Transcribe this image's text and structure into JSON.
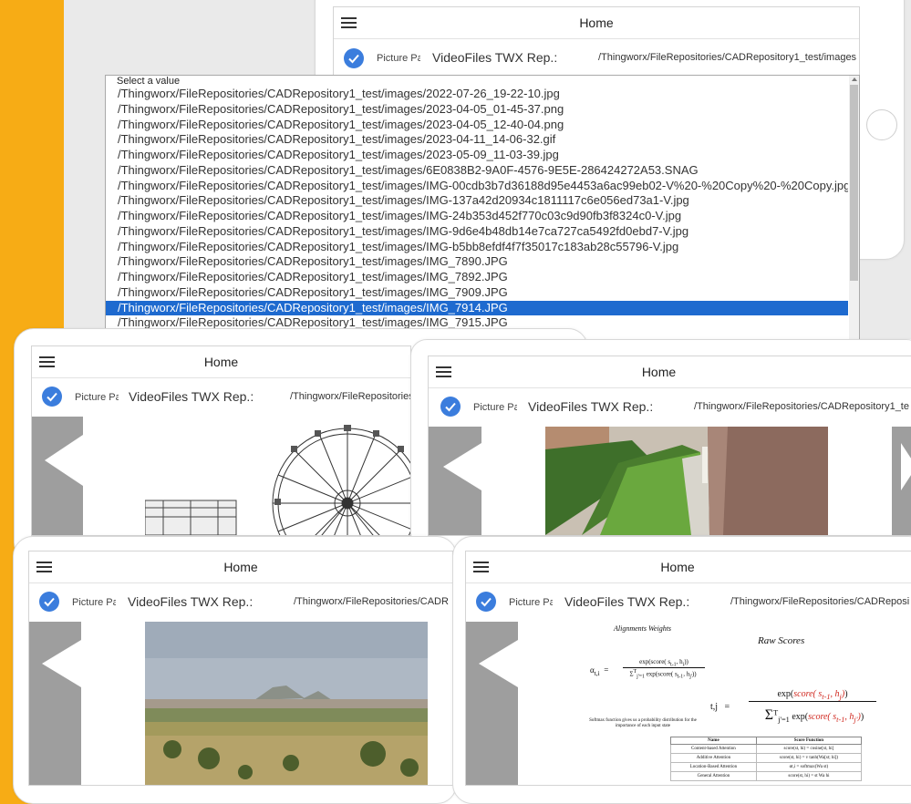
{
  "app": {
    "home_title": "Home",
    "picture_label": "Picture Pa",
    "video_label": "VideoFiles TWX Rep.:",
    "repo_path": "/Thingworx/FileRepositories/CADRepository1_test/images"
  },
  "dropdown": {
    "caption": "Select a value",
    "items": [
      "/Thingworx/FileRepositories/CADRepository1_test/images/2022-07-26_19-22-10.jpg",
      "/Thingworx/FileRepositories/CADRepository1_test/images/2023-04-05_01-45-37.png",
      "/Thingworx/FileRepositories/CADRepository1_test/images/2023-04-05_12-40-04.png",
      "/Thingworx/FileRepositories/CADRepository1_test/images/2023-04-11_14-06-32.gif",
      "/Thingworx/FileRepositories/CADRepository1_test/images/2023-05-09_11-03-39.jpg",
      "/Thingworx/FileRepositories/CADRepository1_test/images/6E0838B2-9A0F-4576-9E5E-286424272A53.SNAG",
      "/Thingworx/FileRepositories/CADRepository1_test/images/IMG-00cdb3b7d36188d95e4453a6ac99eb02-V%20-%20Copy%20-%20Copy.jpg",
      "/Thingworx/FileRepositories/CADRepository1_test/images/IMG-137a42d20934c1811117c6e056ed73a1-V.jpg",
      "/Thingworx/FileRepositories/CADRepository1_test/images/IMG-24b353d452f770c03c9d90fb3f8324c0-V.jpg",
      "/Thingworx/FileRepositories/CADRepository1_test/images/IMG-9d6e4b48db14e7ca727ca5492fd0ebd7-V.jpg",
      "/Thingworx/FileRepositories/CADRepository1_test/images/IMG-b5bb8efdf4f7f35017c183ab28c55796-V.jpg",
      "/Thingworx/FileRepositories/CADRepository1_test/images/IMG_7890.JPG",
      "/Thingworx/FileRepositories/CADRepository1_test/images/IMG_7892.JPG",
      "/Thingworx/FileRepositories/CADRepository1_test/images/IMG_7909.JPG",
      "/Thingworx/FileRepositories/CADRepository1_test/images/IMG_7914.JPG",
      "/Thingworx/FileRepositories/CADRepository1_test/images/IMG_7915.JPG"
    ],
    "selected_index": 14
  },
  "windows": {
    "top": {
      "path": "/Thingworx/FileRepositories/CADRepository1_test/images"
    },
    "mid_left": {
      "path": "/Thingworx/FileRepositories"
    },
    "mid_right": {
      "path": "/Thingworx/FileRepositories/CADRepository1_te"
    },
    "bottom_left": {
      "path": "/Thingworx/FileRepositories/CADR"
    },
    "bottom_right": {
      "path": "/Thingworx/FileRepositories/CADReposi"
    }
  },
  "attention_image": {
    "heading": "Alignments Weights",
    "raw_scores": "Raw Scores",
    "softmax_note": "Softmax function gives us a probability distribution for the importance of each input state",
    "table_headers": [
      "Name",
      "Score Function"
    ],
    "table_rows": [
      [
        "Content-based Attention",
        "score(st, hi) = cosine[st, hi]"
      ],
      [
        "Additive Attention",
        "score(st, hi) = v tanh(Wa[st; hi])"
      ],
      [
        "Location-Based Attention",
        "αt,i = softmax(Wa st)"
      ],
      [
        "General Attention",
        "score(st, hi) = st Wa hi"
      ]
    ]
  },
  "colors": {
    "accent_orange": "#F7AC15",
    "selection_blue": "#1E6ACF",
    "check_blue": "#3B7DDD"
  }
}
